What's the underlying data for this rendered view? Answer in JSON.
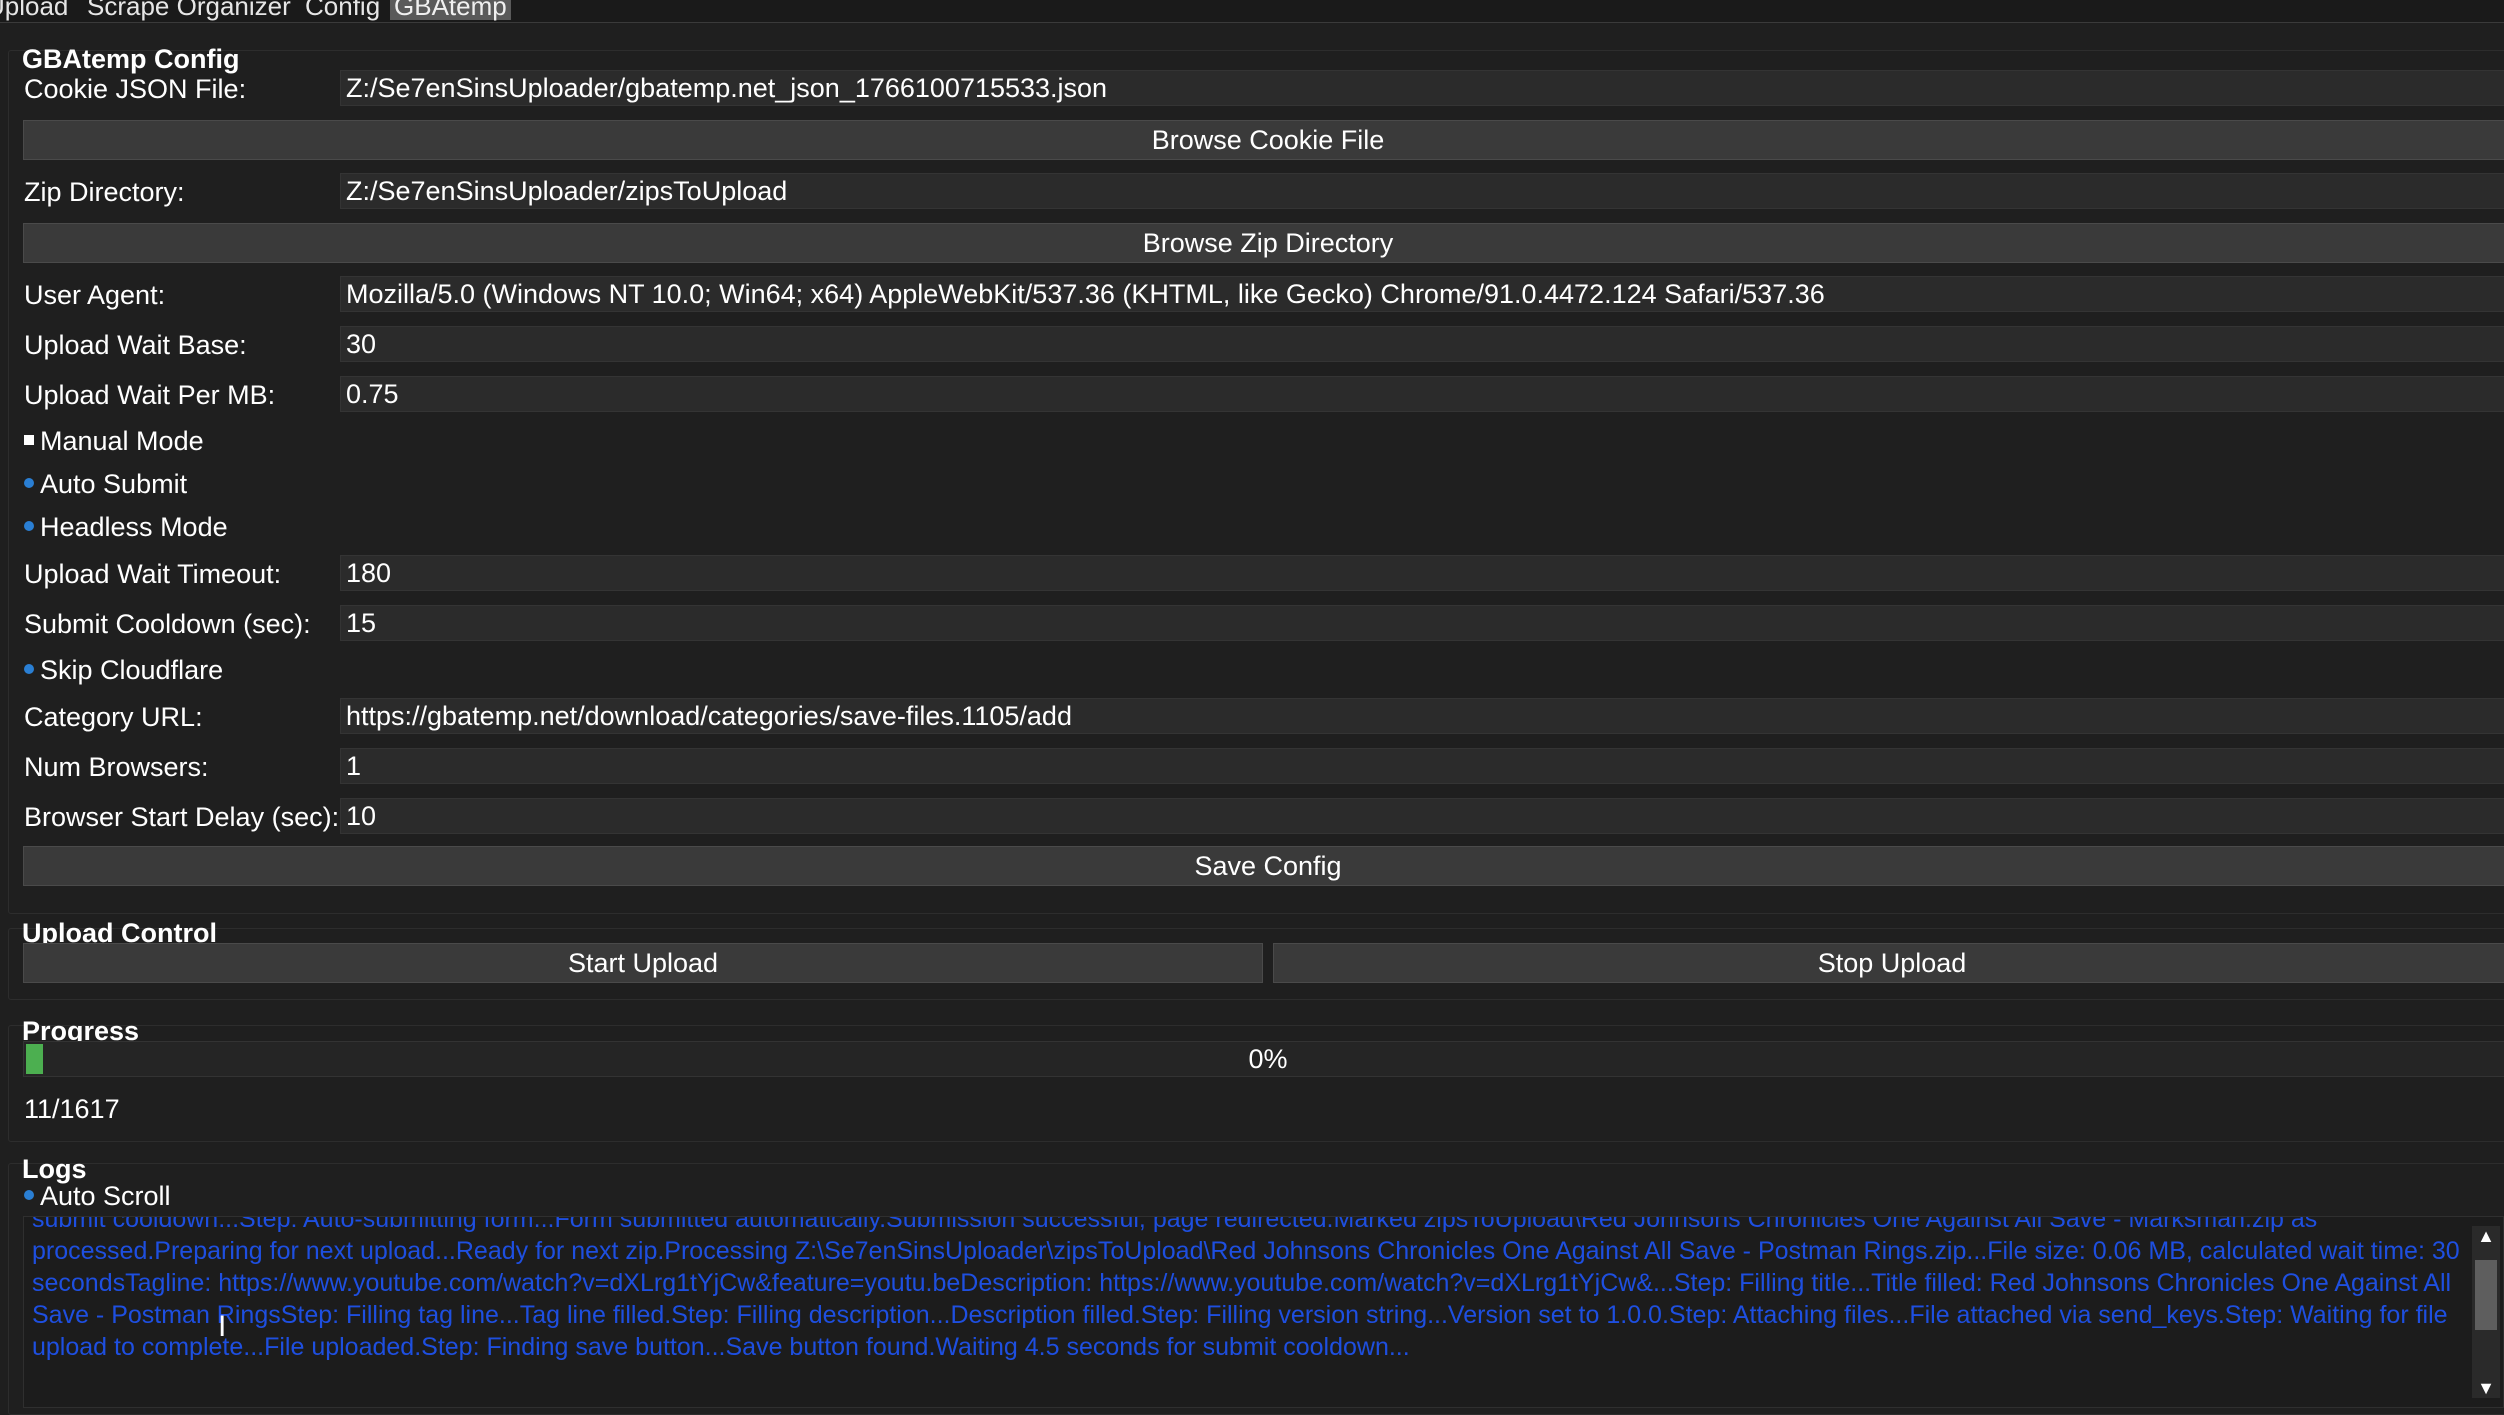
{
  "tabs": [
    "Upload",
    "Scrape Organizer",
    "Config",
    "GBAtemp"
  ],
  "active_tab": "GBAtemp",
  "config": {
    "title": "GBAtemp Config",
    "cookie_label": "Cookie JSON File:",
    "cookie_value": "Z:/Se7enSinsUploader/gbatemp.net_json_1766100715533.json",
    "browse_cookie": "Browse Cookie File",
    "zip_label": "Zip Directory:",
    "zip_value": "Z:/Se7enSinsUploader/zipsToUpload",
    "browse_zip": "Browse Zip Directory",
    "ua_label": "User Agent:",
    "ua_value": "Mozilla/5.0 (Windows NT 10.0; Win64; x64) AppleWebKit/537.36 (KHTML, like Gecko) Chrome/91.0.4472.124 Safari/537.36",
    "wait_base_label": "Upload Wait Base:",
    "wait_base_value": "30",
    "wait_mb_label": "Upload Wait Per MB:",
    "wait_mb_value": "0.75",
    "manual_mode": "Manual Mode",
    "manual_mode_checked": true,
    "auto_submit": "Auto Submit",
    "auto_submit_checked": false,
    "headless_mode": "Headless Mode",
    "headless_mode_checked": false,
    "timeout_label": "Upload Wait Timeout:",
    "timeout_value": "180",
    "cooldown_label": "Submit Cooldown (sec):",
    "cooldown_value": "15",
    "skip_cloudflare": "Skip Cloudflare",
    "skip_cloudflare_checked": false,
    "category_label": "Category URL:",
    "category_value": "https://gbatemp.net/download/categories/save-files.1105/add",
    "num_browsers_label": "Num Browsers:",
    "num_browsers_value": "1",
    "start_delay_label": "Browser Start Delay (sec):",
    "start_delay_value": "10",
    "save_config": "Save Config"
  },
  "upload_control": {
    "title": "Upload Control",
    "start": "Start Upload",
    "stop": "Stop Upload"
  },
  "progress": {
    "title": "Progress",
    "percent_text": "0%",
    "fill_fraction": 0.0068,
    "count": "11/1617"
  },
  "logs": {
    "title": "Logs",
    "auto_scroll": "Auto Scroll",
    "auto_scroll_checked": false,
    "text": "submit cooldown...Step: Auto-submitting form...Form submitted automatically.Submission successful, page redirected.Marked zipsToUpload\\Red Johnsons Chronicles One Against All Save - Marksman.zip as processed.Preparing for next upload...Ready for next zip.Processing Z:\\Se7enSinsUploader\\zipsToUpload\\Red Johnsons Chronicles One Against All Save - Postman Rings.zip...File size: 0.06 MB, calculated wait time: 30 secondsTagline: https://www.youtube.com/watch?v=dXLrg1tYjCw&feature=youtu.beDescription: https://www.youtube.com/watch?v=dXLrg1tYjCw&...Step: Filling title...Title filled: Red Johnsons Chronicles One Against All Save - Postman RingsStep: Filling tag line...Tag line filled.Step: Filling description...Description filled.Step: Filling version string...Version set to 1.0.0.Step: Attaching files...File attached via send_keys.Step: Waiting for file upload to complete...File uploaded.Step: Finding save button...Save button found.Waiting 4.5 seconds for submit cooldown..."
  }
}
